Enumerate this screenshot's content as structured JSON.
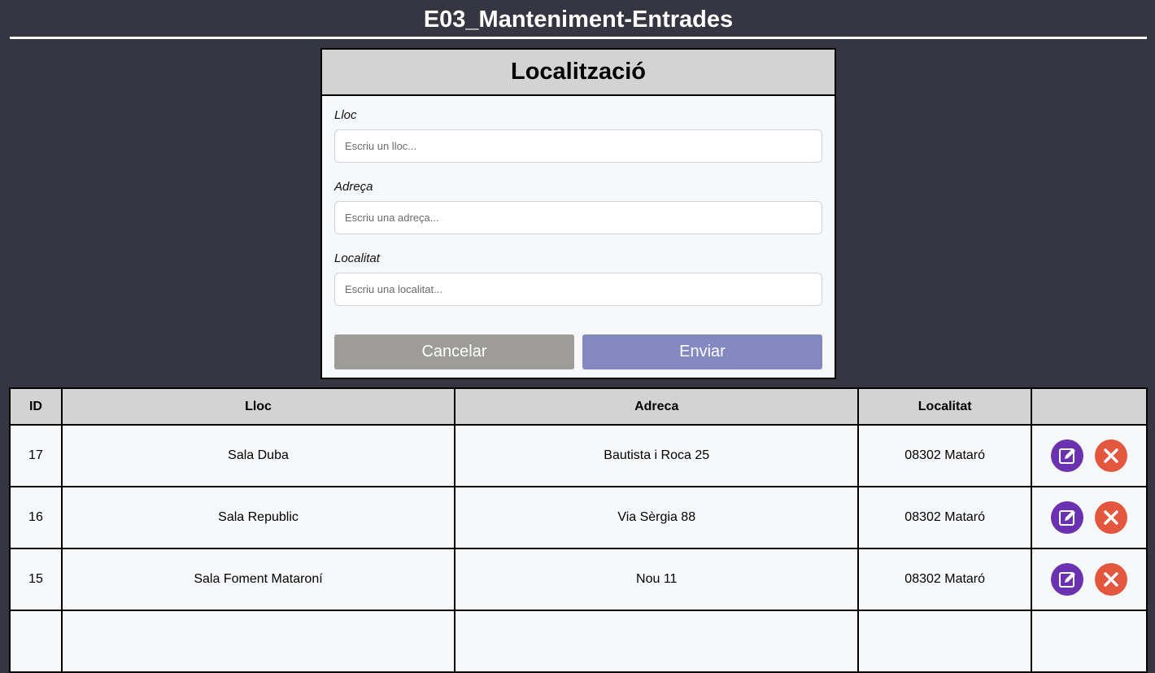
{
  "header": {
    "title": "E03_Manteniment-Entrades"
  },
  "form": {
    "title": "Localització",
    "fields": [
      {
        "label": "Lloc",
        "placeholder": "Escriu un lloc..."
      },
      {
        "label": "Adreça",
        "placeholder": "Escriu una adreça..."
      },
      {
        "label": "Localitat",
        "placeholder": "Escriu una localitat..."
      }
    ],
    "cancel_label": "Cancelar",
    "send_label": "Enviar"
  },
  "table": {
    "headers": [
      "ID",
      "Lloc",
      "Adreca",
      "Localitat",
      ""
    ],
    "rows": [
      {
        "id": "17",
        "lloc": "Sala Duba",
        "adreca": "Bautista i Roca 25",
        "localitat": "08302 Mataró"
      },
      {
        "id": "16",
        "lloc": "Sala Republic",
        "adreca": "Via Sèrgia 88",
        "localitat": "08302 Mataró"
      },
      {
        "id": "15",
        "lloc": "Sala Foment Mataroní",
        "adreca": "Nou 11",
        "localitat": "08302 Mataró"
      },
      {
        "id": "",
        "lloc": "",
        "adreca": "",
        "localitat": ""
      }
    ]
  },
  "icons": {
    "edit": "edit-icon",
    "delete": "close-icon"
  },
  "colors": {
    "background": "#363643",
    "edit": "#6a31b0",
    "delete": "#e4573f",
    "send": "#8388c0",
    "cancel": "#9e9c98"
  }
}
